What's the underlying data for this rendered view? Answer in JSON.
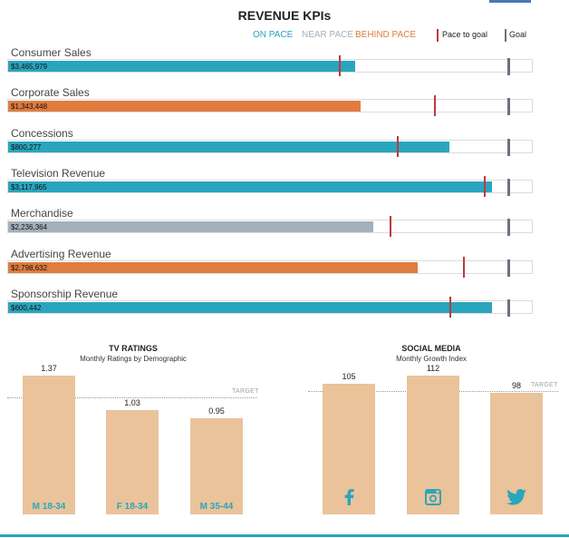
{
  "title": "REVENUE KPIs",
  "legend": {
    "on_pace": "ON PACE",
    "near_pace": "NEAR PACE",
    "behind_pace": "BEHIND PACE",
    "pace_to_goal": "Pace to goal",
    "goal": "Goal"
  },
  "colors": {
    "on_pace": "#2aa5be",
    "near_pace": "#a4b0ba",
    "behind_pace": "#e07c3f",
    "pace_marker": "#c0393b",
    "goal_marker": "#6a7280",
    "column": "#eac39a"
  },
  "chart_data": [
    {
      "type": "bar",
      "title": "REVENUE KPIs",
      "orientation": "horizontal",
      "value_scale": "fraction of goal",
      "items": [
        {
          "name": "Consumer Sales",
          "label": "$3,465,979",
          "value": 0.66,
          "pace": 0.63,
          "goal": 0.95,
          "status": "on_pace"
        },
        {
          "name": "Corporate Sales",
          "label": "$1,343,448",
          "value": 0.67,
          "pace": 0.81,
          "goal": 0.95,
          "status": "behind_pace"
        },
        {
          "name": "Concessions",
          "label": "$800,277",
          "value": 0.84,
          "pace": 0.74,
          "goal": 0.95,
          "status": "on_pace"
        },
        {
          "name": "Television Revenue",
          "label": "$3,117,965",
          "value": 0.92,
          "pace": 0.905,
          "goal": 0.95,
          "status": "on_pace"
        },
        {
          "name": "Merchandise",
          "label": "$2,236,364",
          "value": 0.695,
          "pace": 0.725,
          "goal": 0.95,
          "status": "near_pace"
        },
        {
          "name": "Advertising Revenue",
          "label": "$2,798,632",
          "value": 0.78,
          "pace": 0.865,
          "goal": 0.95,
          "status": "behind_pace"
        },
        {
          "name": "Sponsorship Revenue",
          "label": "$600,442",
          "value": 0.92,
          "pace": 0.84,
          "goal": 0.95,
          "status": "on_pace"
        }
      ]
    },
    {
      "type": "bar",
      "title": "TV RATINGS",
      "subtitle": "Monthly Ratings by Demographic",
      "categories": [
        "M 18-34",
        "F 18-34",
        "M 35-44"
      ],
      "values": [
        1.37,
        1.03,
        0.95
      ],
      "value_labels": [
        "1.37",
        "1.03",
        "0.95"
      ],
      "target_label": "TARGET",
      "target": 1.11,
      "ylim": [
        0,
        1.45
      ]
    },
    {
      "type": "bar",
      "title": "SOCIAL MEDIA",
      "subtitle": "Monthly Growth Index",
      "categories": [
        "facebook",
        "instagram",
        "twitter"
      ],
      "category_icons": [
        "facebook-icon",
        "instagram-icon",
        "twitter-icon"
      ],
      "values": [
        105,
        112,
        98
      ],
      "value_labels": [
        "105",
        "112",
        "98"
      ],
      "target_label": "TARGET",
      "target": 101.5,
      "ylim": [
        0,
        117
      ]
    }
  ]
}
